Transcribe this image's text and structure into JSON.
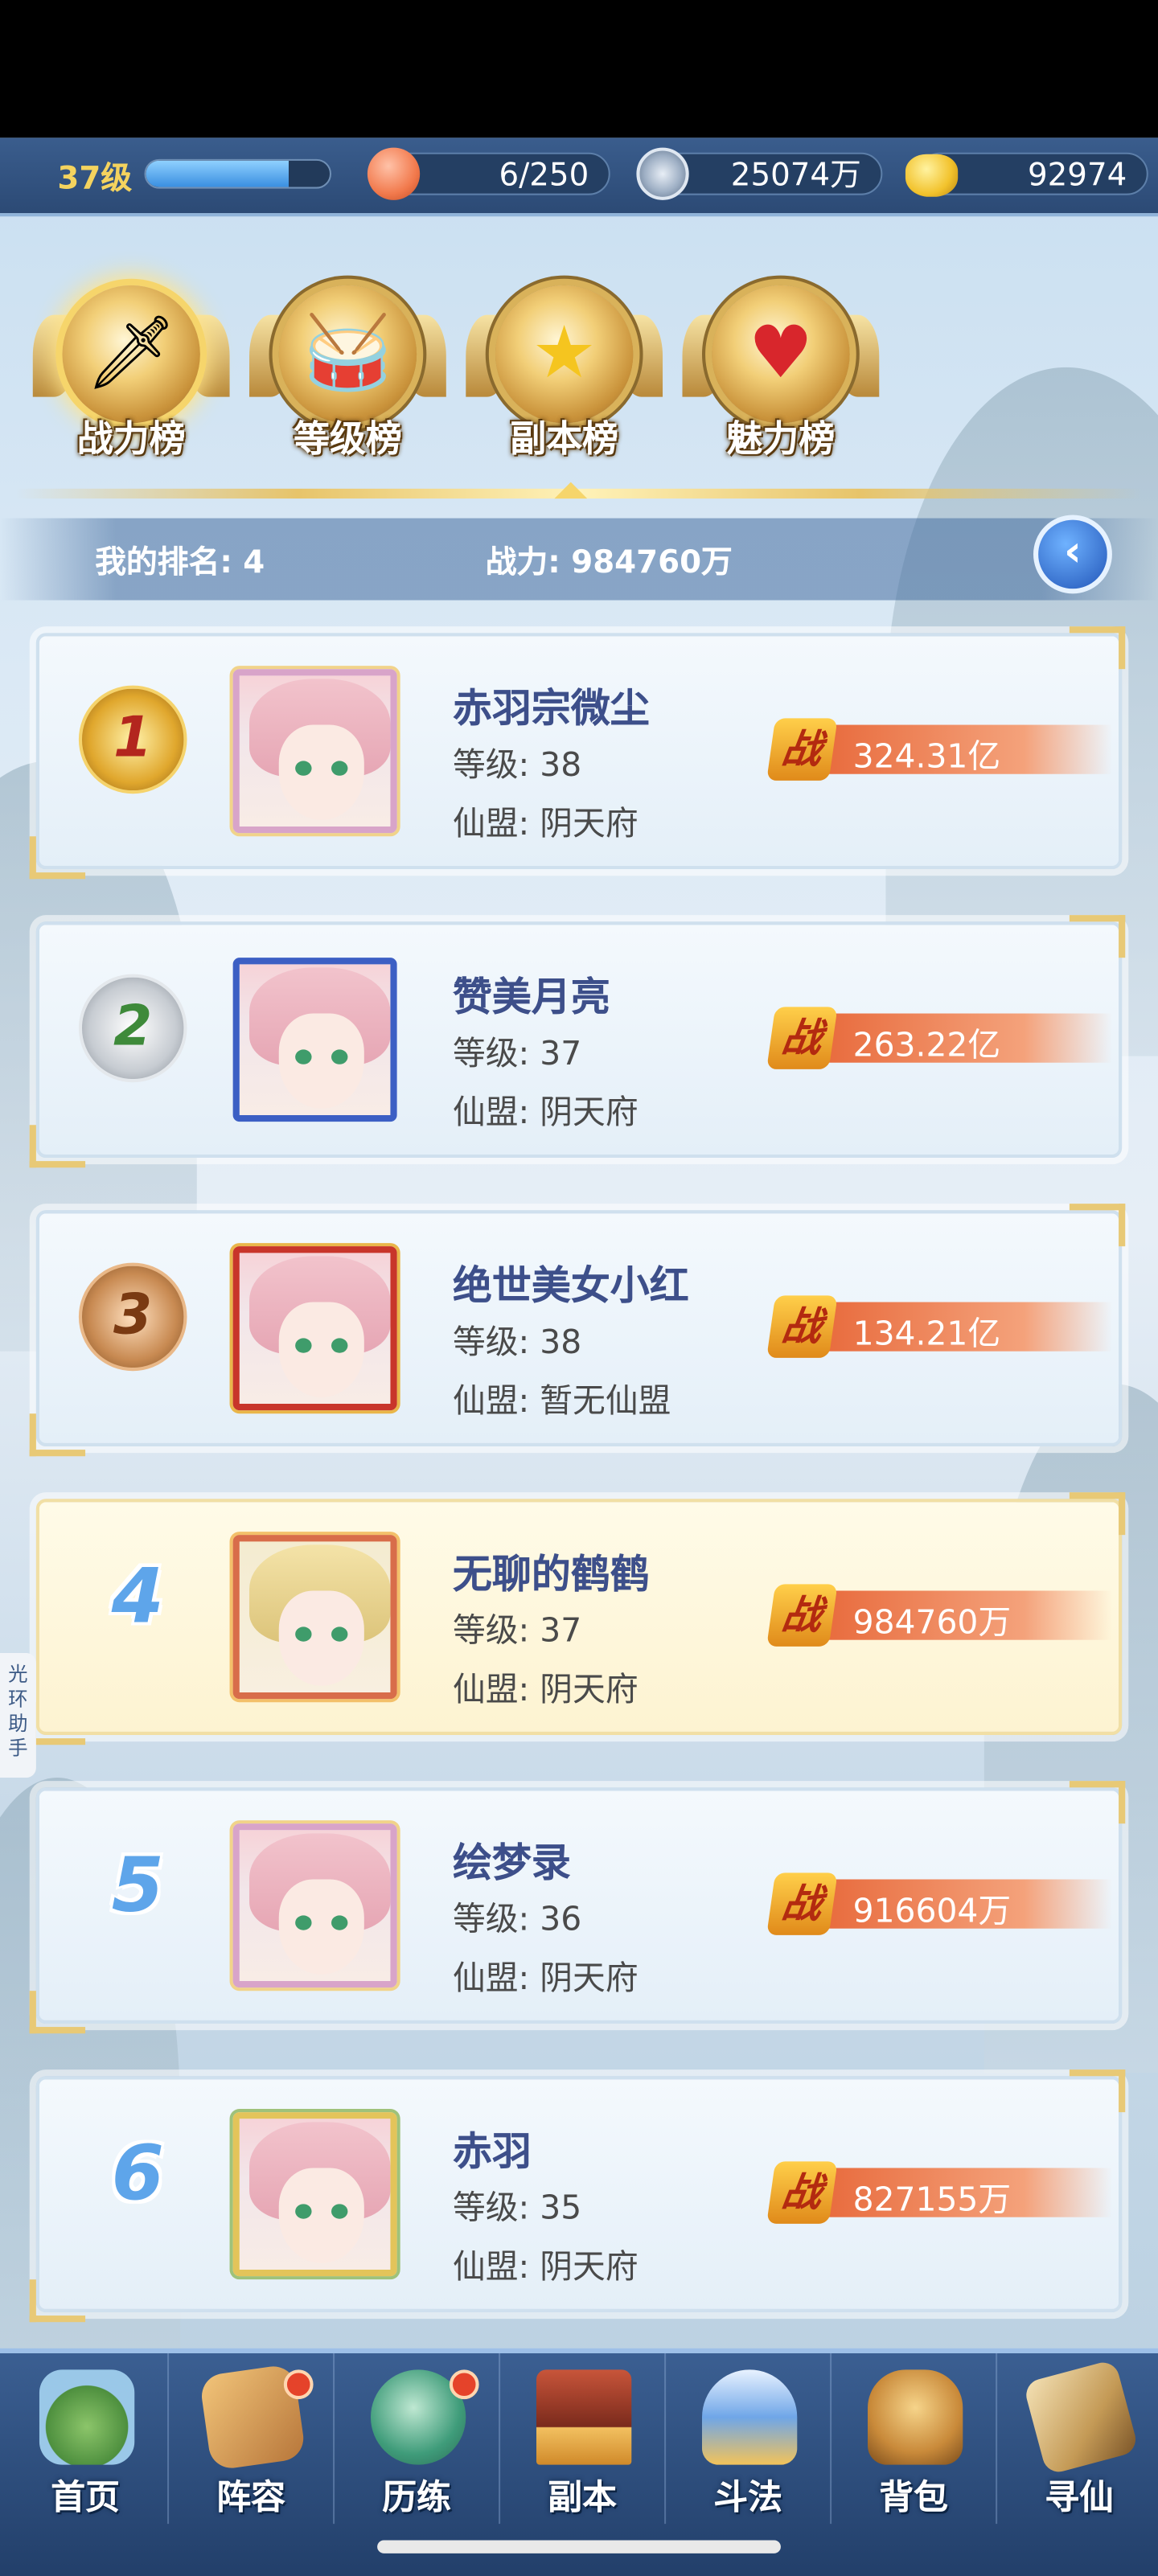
{
  "resources": {
    "level_label": "37级",
    "level_progress": 0.78,
    "stamina": "6/250",
    "coins": "25074万",
    "ingots": "92974"
  },
  "tabs": [
    {
      "label": "战力榜",
      "icon": "sword-emblem-icon",
      "active": true
    },
    {
      "label": "等级榜",
      "icon": "drum-emblem-icon",
      "active": false
    },
    {
      "label": "副本榜",
      "icon": "star-emblem-icon",
      "active": false
    },
    {
      "label": "魅力榜",
      "icon": "heart-emblem-icon",
      "active": false
    }
  ],
  "my_rank": {
    "rank_text": "我的排名: 4",
    "power_text": "战力: 984760万"
  },
  "rows": [
    {
      "rank": "1",
      "name": "赤羽宗微尘",
      "level": "等级: 38",
      "guild": "仙盟: 阴天府",
      "power": "324.31亿"
    },
    {
      "rank": "2",
      "name": "赞美月亮",
      "level": "等级: 37",
      "guild": "仙盟: 阴天府",
      "power": "263.22亿"
    },
    {
      "rank": "3",
      "name": "绝世美女小红",
      "level": "等级: 38",
      "guild": "仙盟: 暂无仙盟",
      "power": "134.21亿"
    },
    {
      "rank": "4",
      "name": "无聊的鹤鹤",
      "level": "等级: 37",
      "guild": "仙盟: 阴天府",
      "power": "984760万"
    },
    {
      "rank": "5",
      "name": "绘梦录",
      "level": "等级: 36",
      "guild": "仙盟: 阴天府",
      "power": "916604万"
    },
    {
      "rank": "6",
      "name": "赤羽",
      "level": "等级: 35",
      "guild": "仙盟: 阴天府",
      "power": "827155万"
    }
  ],
  "power_badge": "战",
  "side_tab": "光环助手",
  "nav": [
    {
      "label": "首页",
      "icon": "home-island-icon",
      "badge": false
    },
    {
      "label": "阵容",
      "icon": "cards-icon",
      "badge": true
    },
    {
      "label": "历练",
      "icon": "turtle-icon",
      "badge": true
    },
    {
      "label": "副本",
      "icon": "gate-icon",
      "badge": false
    },
    {
      "label": "斗法",
      "icon": "sword-crest-icon",
      "badge": false
    },
    {
      "label": "背包",
      "icon": "bag-icon",
      "badge": false
    },
    {
      "label": "寻仙",
      "icon": "scroll-icon",
      "badge": false
    }
  ],
  "colors": {
    "title_text": "#3d4f8a",
    "power_bar": "#e86a3c",
    "nav_bg": "#2c4a75"
  }
}
